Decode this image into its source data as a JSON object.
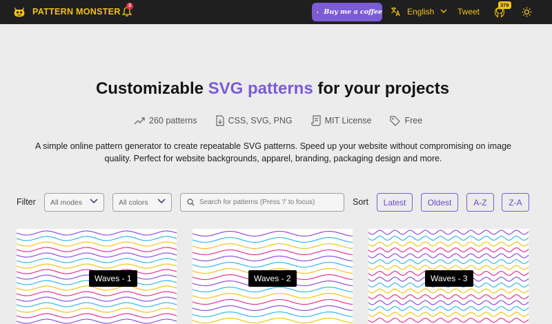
{
  "header": {
    "brand": "PATTERN MONSTER",
    "notification_count": "3",
    "coffee_label": "Buy me a coffee",
    "language": "English",
    "tweet_label": "Tweet",
    "github_stars": "379",
    "colors": {
      "bar": "#1f1f1f",
      "brand": "#f2c318",
      "coffee": "#7b5bd6",
      "badge": "#e2344a"
    }
  },
  "hero": {
    "title_prefix": "Customizable ",
    "title_accent": "SVG patterns",
    "title_suffix": " for your projects",
    "accent_color": "#7b5bd6",
    "features": [
      {
        "icon": "trending-icon",
        "label": "260 patterns"
      },
      {
        "icon": "file-download-icon",
        "label": "CSS, SVG, PNG"
      },
      {
        "icon": "license-icon",
        "label": "MIT License"
      },
      {
        "icon": "tag-icon",
        "label": "Free"
      }
    ],
    "description": "A simple online pattern generator to create repeatable SVG patterns. Speed up your website without compromising on image quality. Perfect for website backgrounds, apparel, branding, packaging design and more."
  },
  "filters": {
    "filter_label": "Filter",
    "mode_select": "All modes",
    "color_select": "All colors",
    "search_placeholder": "Search for patterns (Press '/' to focus)",
    "sort_label": "Sort",
    "sort_options": [
      "Latest",
      "Oldest",
      "A-Z",
      "Z-A"
    ]
  },
  "patterns": [
    {
      "label": "Waves - 1",
      "colors": [
        "#8a4de0",
        "#33b8e6",
        "#f2c318",
        "#e8308f"
      ]
    },
    {
      "label": "Waves - 2",
      "colors": [
        "#8a4de0",
        "#33b8e6",
        "#f2c318",
        "#e8308f"
      ]
    },
    {
      "label": "Waves - 3",
      "colors": [
        "#8a4de0",
        "#33b8e6",
        "#f2c318",
        "#e8308f"
      ]
    }
  ]
}
